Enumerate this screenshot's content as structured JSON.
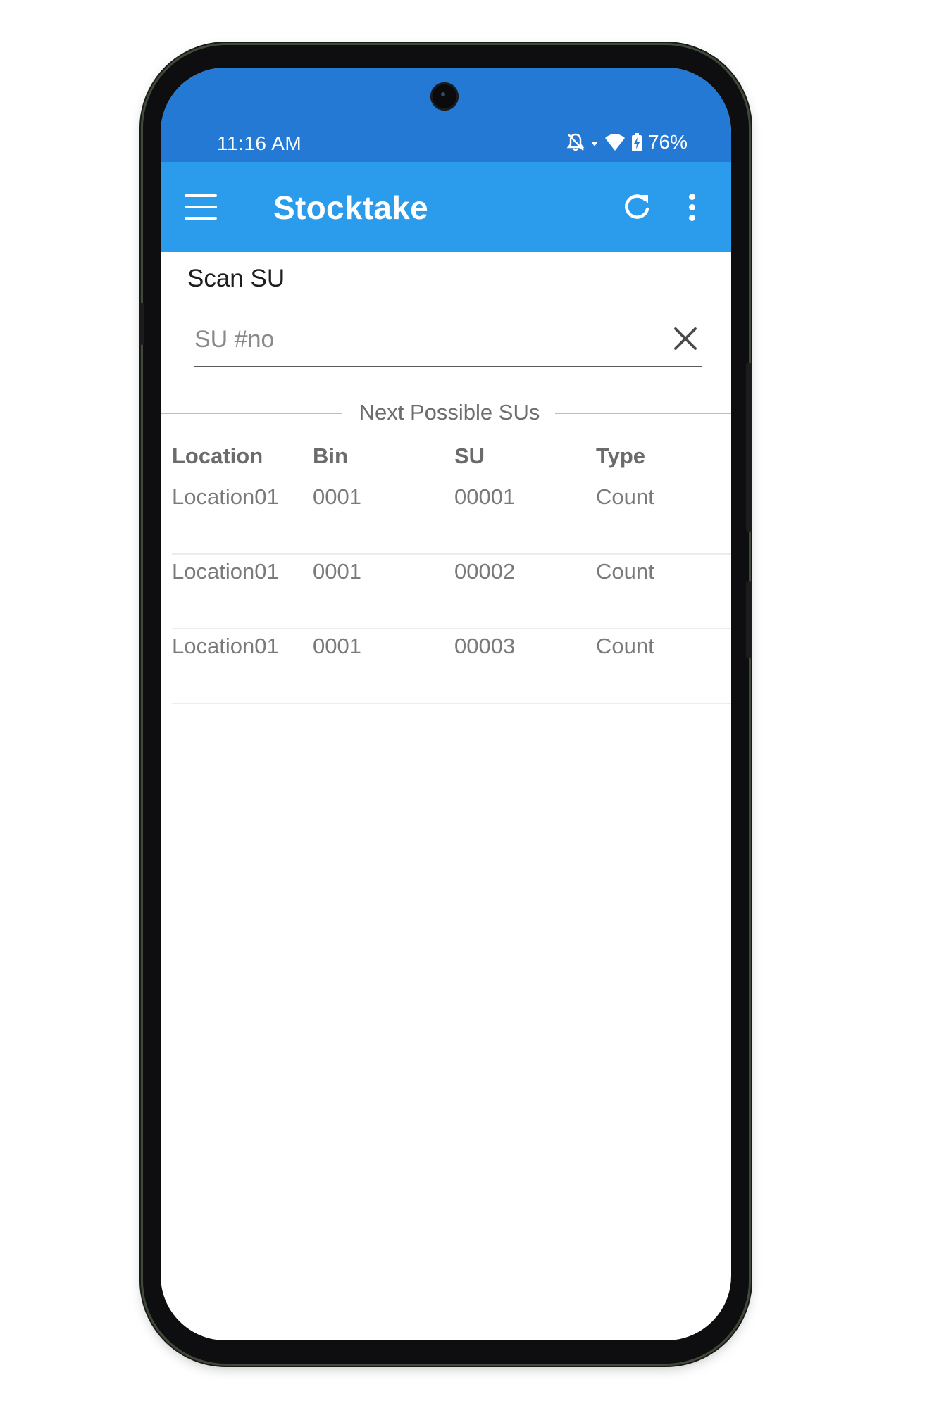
{
  "status_bar": {
    "time": "11:16 AM",
    "battery": "76%",
    "icons": [
      "notifications-off-icon",
      "signal-arrows-icon",
      "wifi-icon",
      "battery-charging-icon"
    ]
  },
  "app_bar": {
    "title": "Stocktake",
    "background": "#2b9bec",
    "status_background": "#2379d3",
    "icons": [
      "menu-icon",
      "refresh-icon",
      "more-vertical-icon"
    ]
  },
  "scan": {
    "label": "Scan SU",
    "input_value": "",
    "input_placeholder": "SU #no",
    "clear_icon": "close-icon"
  },
  "next_sus": {
    "section_title": "Next Possible SUs",
    "columns": [
      "Location",
      "Bin",
      "SU",
      "Type"
    ],
    "rows": [
      [
        "Location01",
        "0001",
        "00001",
        "Count"
      ],
      [
        "Location01",
        "0001",
        "00002",
        "Count"
      ],
      [
        "Location01",
        "0001",
        "00003",
        "Count"
      ]
    ]
  }
}
